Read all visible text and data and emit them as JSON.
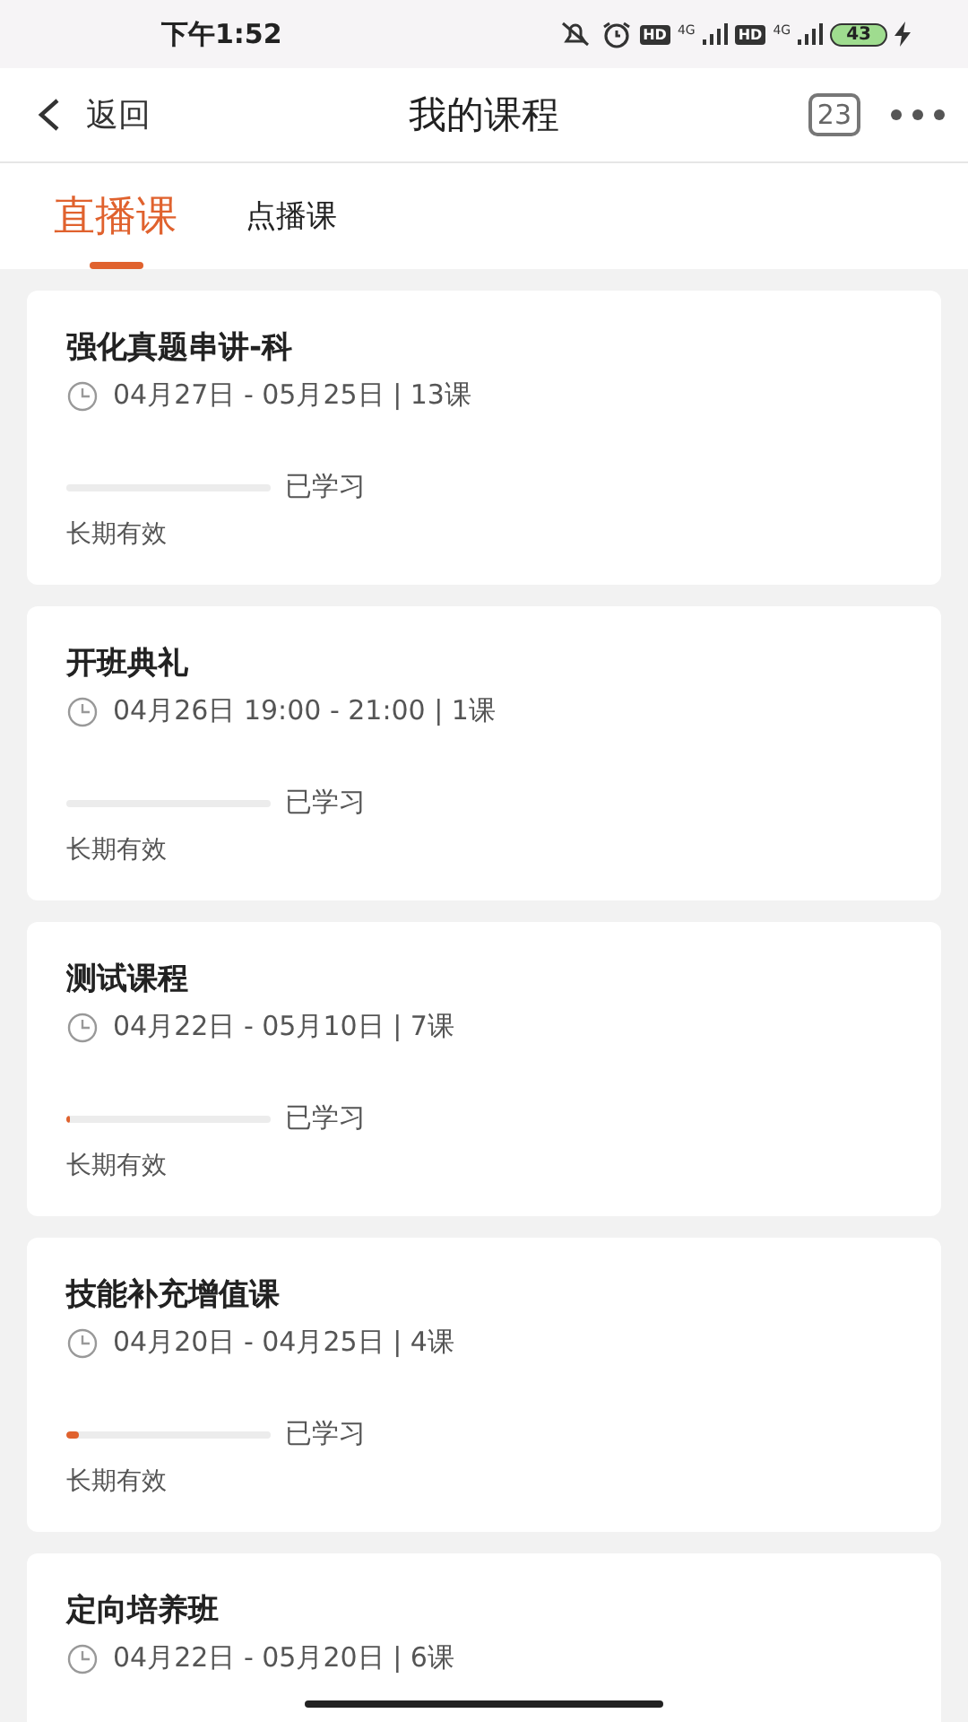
{
  "status_bar": {
    "time": "下午1:52",
    "hd_1": "HD",
    "network_1": "4G",
    "hd_2": "HD",
    "network_2": "4G",
    "battery": "43"
  },
  "nav_bar": {
    "back": "返回",
    "title": "我的课程",
    "calendar_day": "23"
  },
  "tabs": [
    {
      "label": "直播课",
      "selected": true
    },
    {
      "label": "点播课",
      "selected": false
    }
  ],
  "courses": [
    {
      "title": "强化真题串讲-科",
      "schedule": "04月27日 - 05月25日 | 13课",
      "level": 0,
      "progress_label": "已学习",
      "validity": "长期有效"
    },
    {
      "title": "开班典礼",
      "schedule": "04月26日 19:00 -  21:00 | 1课",
      "level": 0,
      "progress_label": "已学习",
      "validity": "长期有效"
    },
    {
      "title": "测试课程",
      "schedule": "04月22日 - 05月10日 | 7课",
      "level": 0.02,
      "progress_label": "已学习",
      "validity": "长期有效"
    },
    {
      "title": "技能补充增值课",
      "schedule": "04月20日 - 04月25日 | 4课",
      "level": 0.06,
      "progress_label": "已学习",
      "validity": "长期有效"
    },
    {
      "title": "定向培养班",
      "schedule": "04月22日 - 05月20日 | 6课"
    }
  ]
}
